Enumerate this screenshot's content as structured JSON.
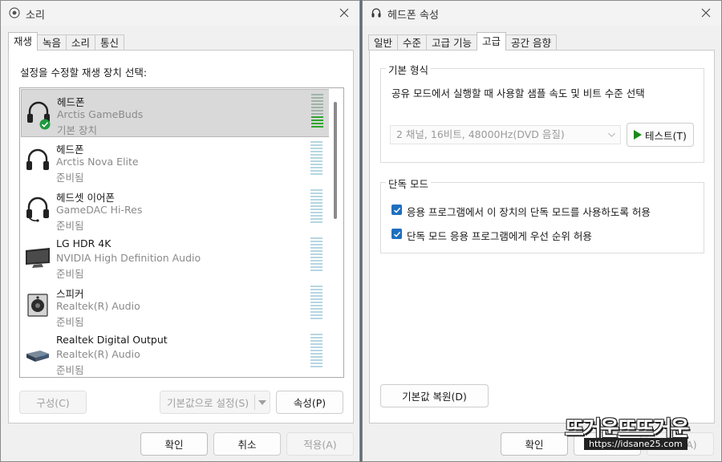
{
  "sound": {
    "title": "소리",
    "tabs": [
      "재생",
      "녹음",
      "소리",
      "통신"
    ],
    "instruction": "설정을 수정할 재생 장치 선택:",
    "devices": [
      {
        "name": "헤드폰",
        "driver": "Arctis GameBuds",
        "status": "기본 장치",
        "icon": "headphones-icon"
      },
      {
        "name": "헤드폰",
        "driver": "Arctis Nova Elite",
        "status": "준비됨",
        "icon": "headphones-icon"
      },
      {
        "name": "헤드셋 이어폰",
        "driver": "GameDAC Hi-Res",
        "status": "준비됨",
        "icon": "headset-icon"
      },
      {
        "name": "LG HDR 4K",
        "driver": "NVIDIA High Definition Audio",
        "status": "준비됨",
        "icon": "monitor-icon"
      },
      {
        "name": "스피커",
        "driver": "Realtek(R) Audio",
        "status": "준비됨",
        "icon": "speaker-icon"
      },
      {
        "name": "Realtek Digital Output",
        "driver": "Realtek(R) Audio",
        "status": "준비됨",
        "icon": "digital-output-icon"
      }
    ],
    "configure_label": "구성(C)",
    "set_default_label": "기본값으로 설정(S)",
    "properties_label": "속성(P)",
    "ok_label": "확인",
    "cancel_label": "취소",
    "apply_label": "적용(A)"
  },
  "props": {
    "title": "헤드폰 속성",
    "tabs": [
      "일반",
      "수준",
      "고급 기능",
      "고급",
      "공간 음향"
    ],
    "default_format": {
      "legend": "기본 형식",
      "description": "공유 모드에서 실행할 때 사용할 샘플 속도 및 비트 수준 선택",
      "selected": "2 채널, 16비트, 48000Hz(DVD 음질)",
      "test_label": "테스트(T)"
    },
    "exclusive": {
      "legend": "단독 모드",
      "allow_exclusive": "응용 프로그램에서 이 장치의 단독 모드를 사용하도록 허용",
      "priority": "단독 모드 응용 프로그램에게 우선 순위 허용"
    },
    "restore_label": "기본값 복원(D)",
    "ok_label": "확인",
    "cancel_label": "취소",
    "apply_label": "적용(A)"
  },
  "watermark": {
    "logo_text": "뜨거운뜨뜨거운",
    "url": "https://idsane25.com"
  },
  "colors": {
    "accent": "#1f6fbf",
    "meter_active": "#2fa62f",
    "meter_idle": "#b6d6e2",
    "default_check": "#1f9a3e"
  }
}
